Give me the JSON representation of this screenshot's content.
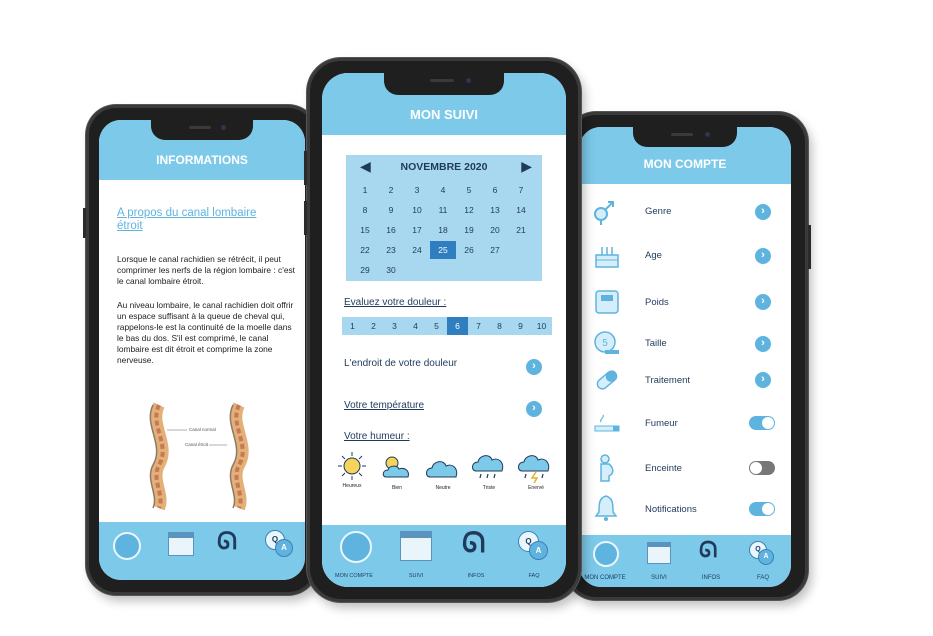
{
  "left": {
    "header": "INFORMATIONS",
    "article_title": "A propos du canal lombaire étroit",
    "para1": "Lorsque le canal rachidien se rétrécit, il peut comprimer les nerfs de la région lombaire : c'est le canal lombaire étroit.",
    "para2": "Au niveau lombaire, le canal rachidien doit offrir un espace suffisant à la queue de cheval qui, rappelons-le est la continuité de la moelle dans le bas du dos. S'il est comprimé, le canal lombaire est dit étroit et comprime la zone nerveuse.",
    "fig_label_normal": "Canal normal",
    "fig_label_narrow": "Canal étroit"
  },
  "middle": {
    "header": "MON SUIVI",
    "calendar": {
      "month": "NOVEMBRE 2020",
      "weeks": [
        [
          "1",
          "2",
          "3",
          "4",
          "5",
          "6",
          "7"
        ],
        [
          "8",
          "9",
          "10",
          "11",
          "12",
          "13",
          "14"
        ],
        [
          "15",
          "16",
          "17",
          "18",
          "19",
          "20",
          "21"
        ],
        [
          "22",
          "23",
          "24",
          "25",
          "26",
          "27"
        ],
        [
          "29",
          "30"
        ]
      ],
      "selected_day": "25"
    },
    "pain_label": "Evaluez votre douleur :",
    "pain_scale": [
      "1",
      "2",
      "3",
      "4",
      "5",
      "6",
      "7",
      "8",
      "9",
      "10"
    ],
    "pain_selected": "6",
    "location_label": "L'endroit de votre douleur",
    "temperature_label": "Votre température",
    "mood_label": "Votre humeur :",
    "moods": [
      "Heureux",
      "Bien",
      "Neutre",
      "Triste",
      "Enervé"
    ]
  },
  "right": {
    "header": "MON COMPTE",
    "rows": [
      {
        "label": "Genre",
        "control": "chevron",
        "icon": "gender-icon"
      },
      {
        "label": "Age",
        "control": "chevron",
        "icon": "cake-icon"
      },
      {
        "label": "Poids",
        "control": "chevron",
        "icon": "scale-icon"
      },
      {
        "label": "Taille",
        "control": "chevron",
        "icon": "tape-measure-icon"
      },
      {
        "label": "Traitement",
        "control": "chevron",
        "icon": "pill-icon"
      },
      {
        "label": "Fumeur",
        "control": "toggle",
        "on": true,
        "icon": "cigarette-icon"
      },
      {
        "label": "Enceinte",
        "control": "toggle",
        "on": false,
        "icon": "pregnant-icon"
      },
      {
        "label": "Notifications",
        "control": "toggle",
        "on": true,
        "icon": "bell-icon"
      }
    ]
  },
  "tabs": {
    "account": "MON COMPTE",
    "suivi": "SUIVI",
    "infos": "INFOS",
    "faq": "FAQ",
    "qa_q": "Q",
    "qa_a": "A"
  },
  "colors": {
    "header_blue": "#7dc9ea",
    "accent_blue": "#5fb4df",
    "calendar_bg": "#a8d8ef",
    "selected_blue": "#2f7fc0"
  }
}
